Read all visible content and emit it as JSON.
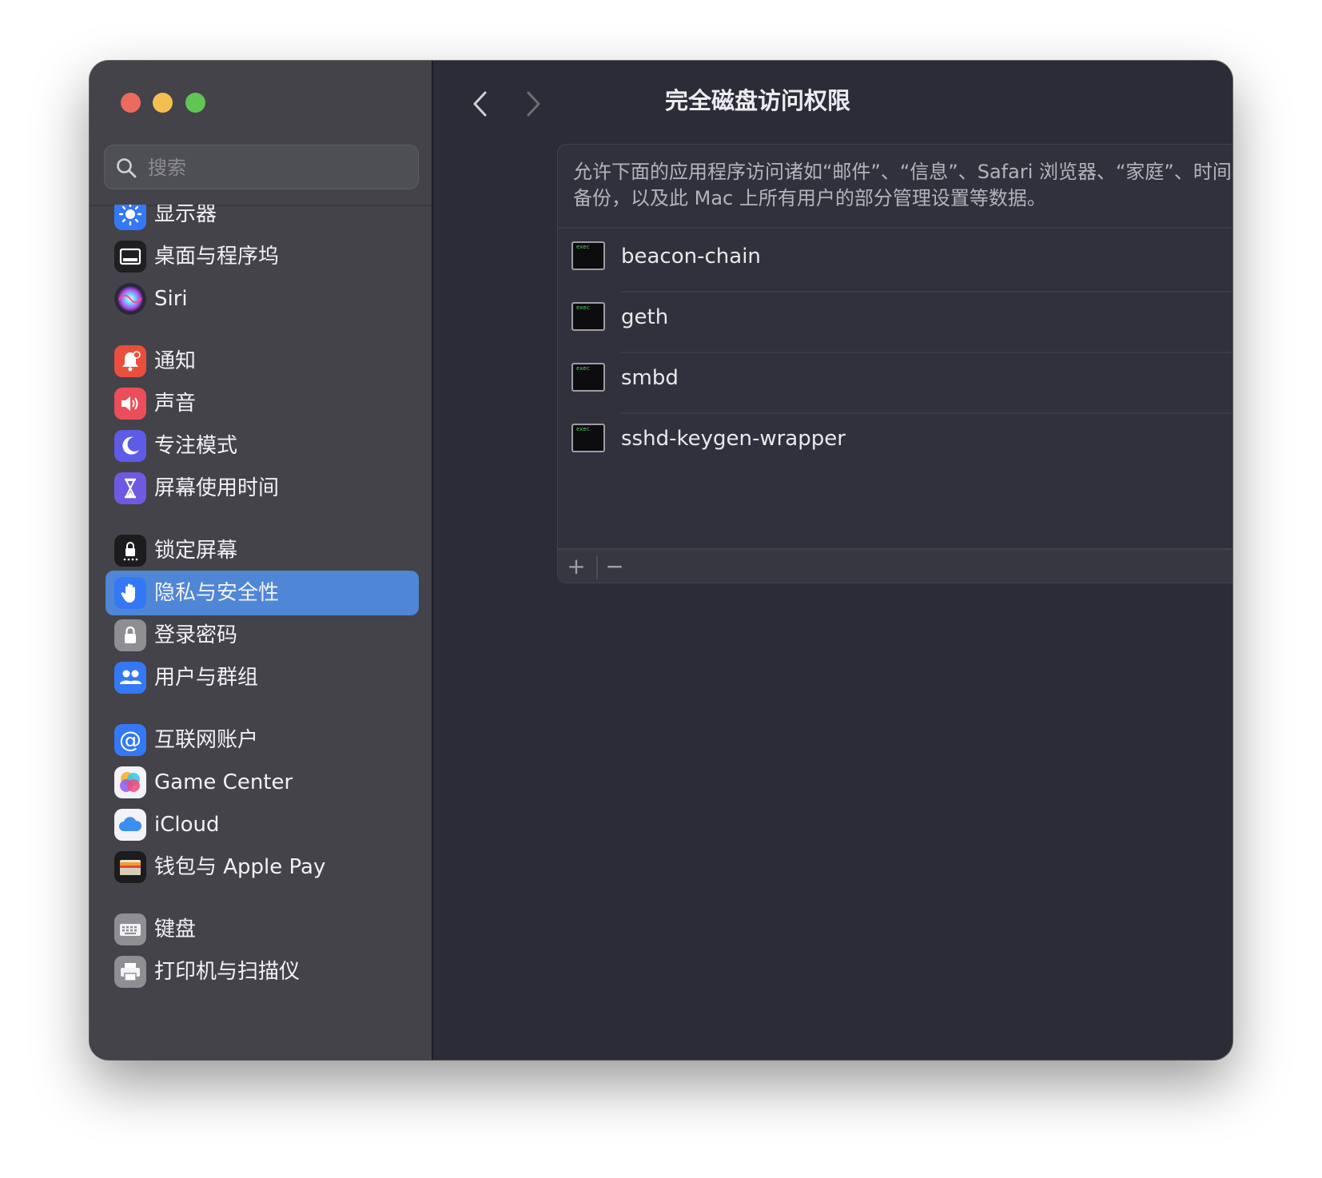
{
  "search": {
    "placeholder": "搜索"
  },
  "sidebar": {
    "items": [
      {
        "label": "显示器",
        "icon": "display-brightness-icon",
        "color": "#3478f6"
      },
      {
        "label": "桌面与程序坞",
        "icon": "dock-icon",
        "color": "#1f1f22"
      },
      {
        "label": "Siri",
        "icon": "siri-icon",
        "color": "#2a2a36"
      },
      {
        "label": "通知",
        "icon": "notification-bell-icon",
        "color": "#eb4e3d"
      },
      {
        "label": "声音",
        "icon": "speaker-icon",
        "color": "#eb4e5a"
      },
      {
        "label": "专注模式",
        "icon": "moon-icon",
        "color": "#5e5ce6"
      },
      {
        "label": "屏幕使用时间",
        "icon": "hourglass-icon",
        "color": "#6e5ae0"
      },
      {
        "label": "锁定屏幕",
        "icon": "lock-screen-icon",
        "color": "#1c1c1e"
      },
      {
        "label": "隐私与安全性",
        "icon": "hand-icon",
        "color": "#3478f6",
        "active": true
      },
      {
        "label": "登录密码",
        "icon": "padlock-icon",
        "color": "#8e8e93"
      },
      {
        "label": "用户与群组",
        "icon": "users-icon",
        "color": "#3478f6"
      },
      {
        "label": "互联网账户",
        "icon": "at-sign-icon",
        "color": "#3478f6"
      },
      {
        "label": "Game Center",
        "icon": "game-center-icon",
        "color": "#f2f2f7"
      },
      {
        "label": "iCloud",
        "icon": "icloud-icon",
        "color": "#f2f2f7"
      },
      {
        "label": "钱包与 Apple Pay",
        "icon": "wallet-icon",
        "color": "#1c1c1e"
      },
      {
        "label": "键盘",
        "icon": "keyboard-icon",
        "color": "#8e8e93"
      },
      {
        "label": "打印机与扫描仪",
        "icon": "printer-icon",
        "color": "#8e8e93"
      }
    ]
  },
  "header": {
    "title": "完全磁盘访问权限"
  },
  "panel": {
    "description": "允许下面的应用程序访问诸如“邮件”、“信息”、Safari 浏览器、“家庭”、时间机器备份，以及此 Mac 上所有用户的部分管理设置等数据。",
    "exec_badge": "exec",
    "apps": [
      {
        "name": "beacon-chain",
        "enabled": true
      },
      {
        "name": "geth",
        "enabled": true
      },
      {
        "name": "smbd",
        "enabled": true
      },
      {
        "name": "sshd-keygen-wrapper",
        "enabled": true
      }
    ],
    "add_label": "+",
    "remove_label": "−"
  },
  "colors": {
    "accent": "#2f6fd9",
    "selection": "#4f86d6"
  }
}
